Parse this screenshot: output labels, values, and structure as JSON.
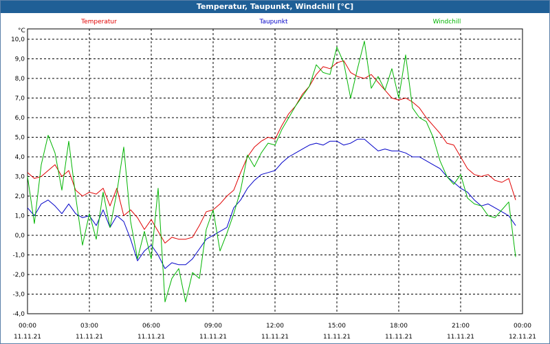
{
  "window": {
    "title": "Temperatur, Taupunkt, Windchill [°C]"
  },
  "colors": {
    "temperature": "#e00000",
    "dewpoint": "#0000c8",
    "windchill": "#00b400",
    "grid": "#000000",
    "titlebar": "#1f5f96"
  },
  "chart_data": {
    "type": "line",
    "title": "Temperatur, Taupunkt, Windchill [°C]",
    "ylabel": "°C",
    "ylim": [
      -4.0,
      10.0
    ],
    "yticks": [
      "10,0",
      "9,0",
      "8,0",
      "7,0",
      "6,0",
      "5,0",
      "4,0",
      "3,0",
      "2,0",
      "1,0",
      "0,0",
      "-1,0",
      "-2,0",
      "-3,0",
      "-4,0"
    ],
    "xlim": [
      "11.11.21 00:00",
      "12.11.21 00:00"
    ],
    "xticks": [
      {
        "time": "00:00",
        "date": "11.11.21"
      },
      {
        "time": "03:00",
        "date": "11.11.21"
      },
      {
        "time": "06:00",
        "date": "11.11.21"
      },
      {
        "time": "09:00",
        "date": "11.11.21"
      },
      {
        "time": "12:00",
        "date": "11.11.21"
      },
      {
        "time": "15:00",
        "date": "11.11.21"
      },
      {
        "time": "18:00",
        "date": "11.11.21"
      },
      {
        "time": "21:00",
        "date": "11.11.21"
      },
      {
        "time": "00:00",
        "date": "12.11.21"
      }
    ],
    "grid": true,
    "x": [
      "11.11.21 00:00",
      "11.11.21 00:20",
      "11.11.21 00:40",
      "11.11.21 01:00",
      "11.11.21 01:20",
      "11.11.21 01:40",
      "11.11.21 02:00",
      "11.11.21 02:20",
      "11.11.21 02:40",
      "11.11.21 03:00",
      "11.11.21 03:20",
      "11.11.21 03:40",
      "11.11.21 04:00",
      "11.11.21 04:20",
      "11.11.21 04:40",
      "11.11.21 05:00",
      "11.11.21 05:20",
      "11.11.21 05:40",
      "11.11.21 06:00",
      "11.11.21 06:20",
      "11.11.21 06:40",
      "11.11.21 07:00",
      "11.11.21 07:20",
      "11.11.21 07:40",
      "11.11.21 08:00",
      "11.11.21 08:20",
      "11.11.21 08:40",
      "11.11.21 09:00",
      "11.11.21 09:20",
      "11.11.21 09:40",
      "11.11.21 10:00",
      "11.11.21 10:20",
      "11.11.21 10:40",
      "11.11.21 11:00",
      "11.11.21 11:20",
      "11.11.21 11:40",
      "11.11.21 12:00",
      "11.11.21 12:20",
      "11.11.21 12:40",
      "11.11.21 13:00",
      "11.11.21 13:20",
      "11.11.21 13:40",
      "11.11.21 14:00",
      "11.11.21 14:20",
      "11.11.21 14:40",
      "11.11.21 15:00",
      "11.11.21 15:20",
      "11.11.21 15:40",
      "11.11.21 16:00",
      "11.11.21 16:20",
      "11.11.21 16:40",
      "11.11.21 17:00",
      "11.11.21 17:20",
      "11.11.21 17:40",
      "11.11.21 18:00",
      "11.11.21 18:20",
      "11.11.21 18:40",
      "11.11.21 19:00",
      "11.11.21 19:20",
      "11.11.21 19:40",
      "11.11.21 20:00",
      "11.11.21 20:20",
      "11.11.21 20:40",
      "11.11.21 21:00",
      "11.11.21 21:20",
      "11.11.21 21:40",
      "11.11.21 22:00",
      "11.11.21 22:20",
      "11.11.21 22:40",
      "11.11.21 23:00",
      "11.11.21 23:20",
      "11.11.21 23:40"
    ],
    "series": [
      {
        "name": "Temperatur",
        "color": "#e00000",
        "values": [
          3.2,
          2.9,
          3.0,
          3.3,
          3.6,
          3.0,
          3.3,
          2.3,
          2.0,
          2.2,
          2.1,
          2.4,
          1.5,
          2.4,
          1.0,
          1.3,
          0.9,
          0.3,
          0.8,
          0.2,
          -0.4,
          -0.1,
          -0.2,
          -0.2,
          -0.1,
          0.5,
          1.2,
          1.3,
          1.6,
          2.0,
          2.3,
          3.2,
          4.0,
          4.5,
          4.8,
          5.0,
          4.9,
          5.6,
          6.2,
          6.6,
          7.2,
          7.6,
          8.2,
          8.6,
          8.5,
          8.8,
          8.9,
          8.3,
          8.1,
          8.0,
          8.2,
          7.8,
          7.4,
          7.0,
          6.9,
          7.0,
          6.8,
          6.5,
          6.0,
          5.6,
          5.2,
          4.7,
          4.6,
          4.0,
          3.4,
          3.1,
          3.0,
          3.1,
          2.8,
          2.7,
          2.9,
          1.8
        ]
      },
      {
        "name": "Taupunkt",
        "color": "#0000c8",
        "values": [
          1.4,
          1.0,
          1.6,
          1.8,
          1.5,
          1.1,
          1.6,
          1.1,
          0.9,
          1.0,
          0.5,
          1.3,
          0.4,
          1.0,
          0.7,
          -0.2,
          -1.3,
          -0.8,
          -0.5,
          -1.0,
          -1.7,
          -1.4,
          -1.5,
          -1.5,
          -1.2,
          -0.7,
          -0.2,
          0.0,
          0.2,
          0.4,
          1.4,
          1.8,
          2.4,
          2.8,
          3.1,
          3.2,
          3.3,
          3.7,
          4.0,
          4.2,
          4.4,
          4.6,
          4.7,
          4.6,
          4.8,
          4.8,
          4.6,
          4.7,
          4.9,
          4.9,
          4.6,
          4.3,
          4.4,
          4.3,
          4.3,
          4.2,
          4.0,
          4.0,
          3.8,
          3.6,
          3.4,
          3.0,
          2.7,
          2.4,
          2.2,
          1.8,
          1.5,
          1.6,
          1.4,
          1.2,
          1.0,
          0.5
        ]
      },
      {
        "name": "Windchill",
        "color": "#00b400",
        "values": [
          3.0,
          0.6,
          3.6,
          5.1,
          4.2,
          2.3,
          4.8,
          2.0,
          -0.5,
          1.1,
          -0.2,
          2.2,
          0.4,
          2.2,
          4.5,
          0.7,
          -1.2,
          0.2,
          -1.2,
          2.4,
          -3.4,
          -2.2,
          -1.7,
          -3.4,
          -1.9,
          -2.2,
          0.3,
          1.3,
          -0.8,
          0.1,
          1.1,
          2.3,
          4.1,
          3.5,
          4.2,
          4.7,
          4.6,
          5.4,
          6.0,
          6.6,
          7.1,
          7.6,
          8.7,
          8.3,
          8.2,
          9.6,
          8.8,
          7.0,
          8.5,
          9.9,
          7.5,
          8.1,
          7.4,
          8.5,
          7.0,
          9.2,
          6.5,
          6.0,
          5.8,
          5.0,
          3.8,
          3.0,
          2.6,
          3.1,
          1.9,
          1.6,
          1.5,
          1.0,
          0.9,
          1.3,
          1.7,
          -1.1
        ]
      }
    ]
  }
}
